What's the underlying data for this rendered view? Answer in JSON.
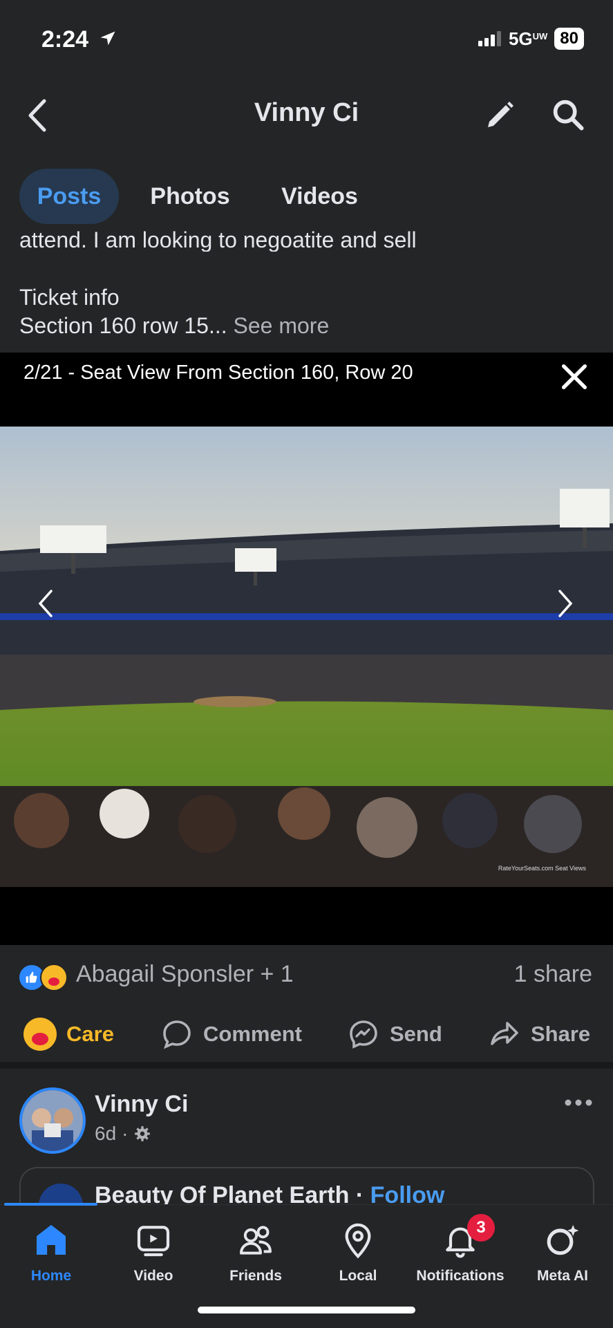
{
  "status_bar": {
    "time": "2:24",
    "network": "5G",
    "network_sub": "UW",
    "battery": "80"
  },
  "header": {
    "title": "Vinny Ci"
  },
  "tabs": [
    {
      "label": "Posts",
      "active": true
    },
    {
      "label": "Photos",
      "active": false
    },
    {
      "label": "Videos",
      "active": false
    }
  ],
  "post": {
    "text_cutoff": "attend. I am looking to negoatite and sell",
    "ticket_label": "Ticket info",
    "ticket_detail": "Section 160 row 15...",
    "see_more": "See more"
  },
  "viewer": {
    "caption": "2/21 - Seat View From Section 160, Row 20",
    "watermark": "RateYourSeats.com Seat Views"
  },
  "reactions": {
    "names": "Abagail Sponsler + 1",
    "shares": "1 share"
  },
  "actions": {
    "care": "Care",
    "comment": "Comment",
    "send": "Send",
    "share": "Share"
  },
  "next_post": {
    "author": "Vinny Ci",
    "time": "6d",
    "dot": "·",
    "shared_title": "Beauty Of Planet Earth",
    "shared_sep": "·",
    "follow": "Follow"
  },
  "bottom_nav": [
    {
      "label": "Home",
      "active": true
    },
    {
      "label": "Video"
    },
    {
      "label": "Friends"
    },
    {
      "label": "Local"
    },
    {
      "label": "Notifications",
      "badge": "3"
    },
    {
      "label": "Meta AI"
    }
  ],
  "colors": {
    "accent": "#2d88ff",
    "care": "#f7b928",
    "badge": "#e41e3f"
  }
}
